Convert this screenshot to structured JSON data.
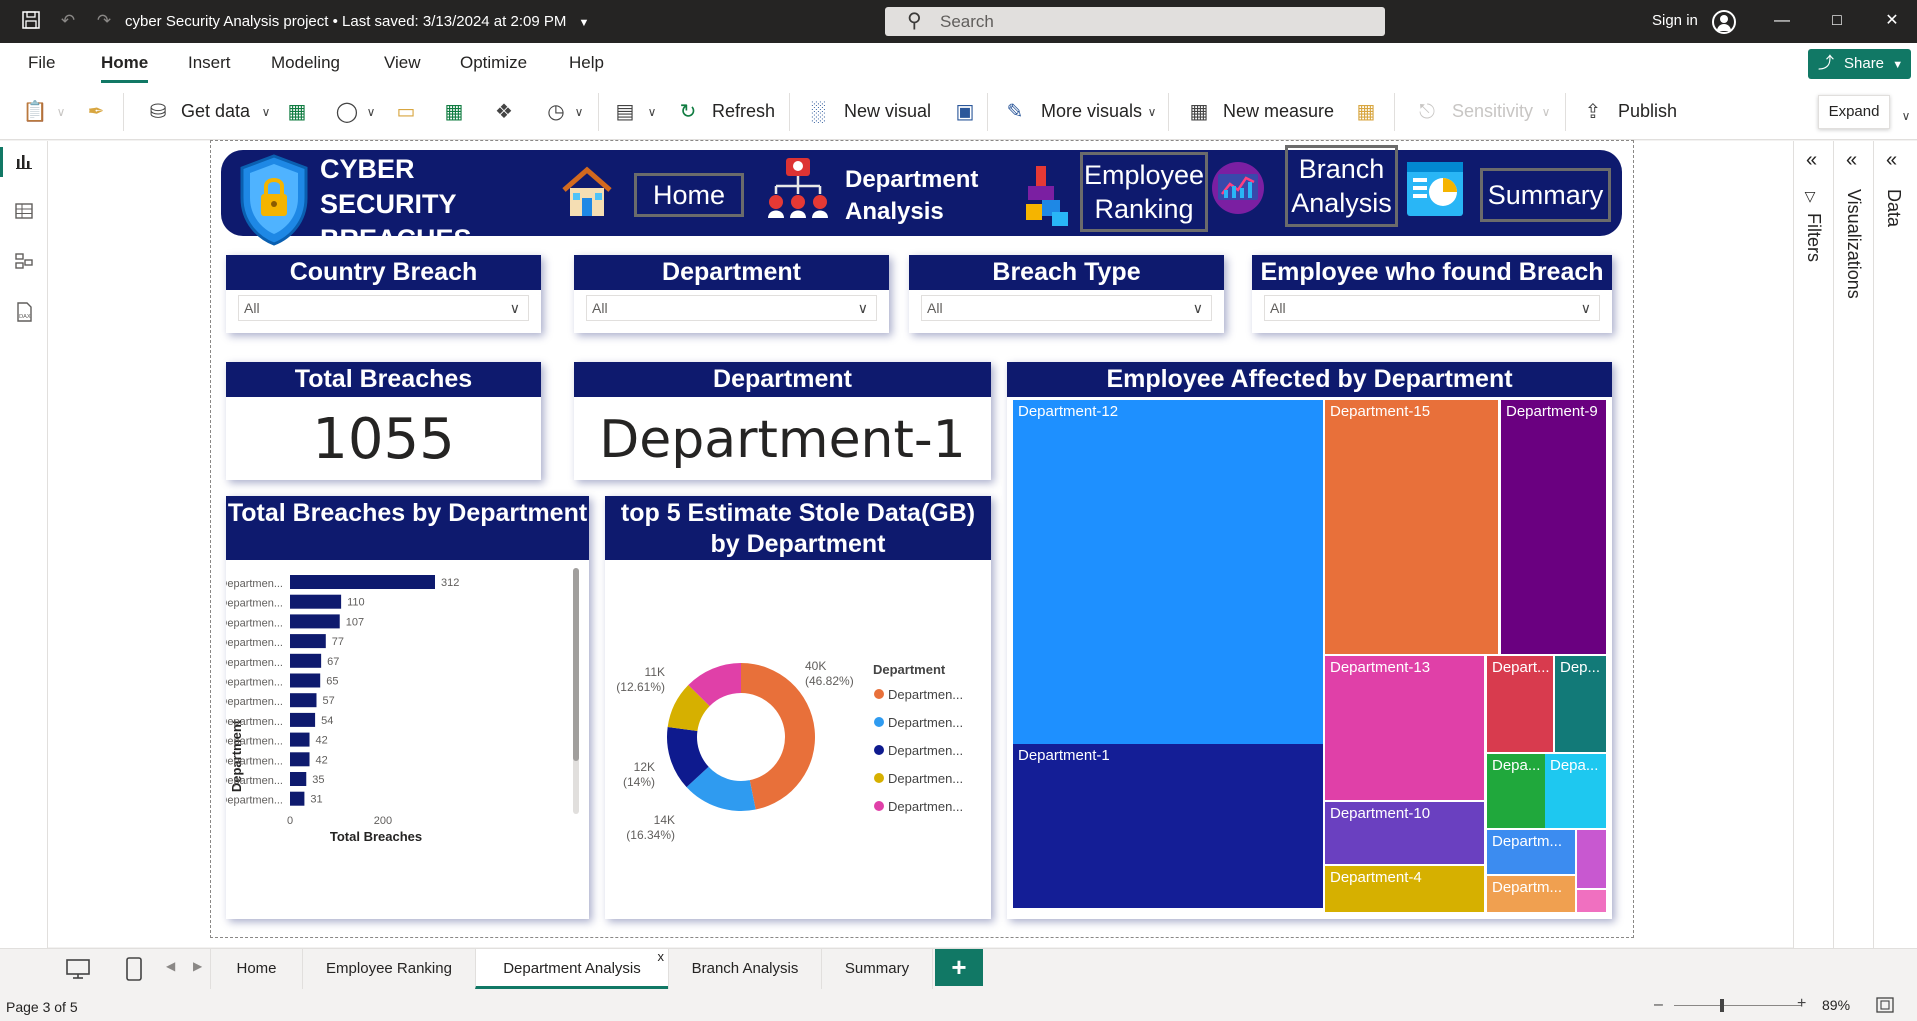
{
  "titlebar": {
    "title": "cyber Security Analysis project",
    "saved": "Last saved: 3/13/2024 at 2:09 PM",
    "search_placeholder": "Search",
    "signin": "Sign in"
  },
  "menu": [
    "File",
    "Home",
    "Insert",
    "Modeling",
    "View",
    "Optimize",
    "Help"
  ],
  "share_label": "Share",
  "ribbon": {
    "get_data": "Get data",
    "refresh": "Refresh",
    "new_visual": "New visual",
    "more_visuals": "More visuals",
    "new_measure": "New measure",
    "sensitivity": "Sensitivity",
    "publish": "Publish"
  },
  "expand_tooltip": "Expand",
  "banner": {
    "title": "CYBER SECURITY BREACHES",
    "nav_home": "Home",
    "nav_department": "Department Analysis",
    "nav_employee": "Employee Ranking",
    "nav_branch": "Branch Analysis",
    "nav_summary": "Summary"
  },
  "slicers": [
    {
      "title": "Country Breach",
      "value": "All"
    },
    {
      "title": "Department",
      "value": "All"
    },
    {
      "title": "Breach Type",
      "value": "All"
    },
    {
      "title": "Employee who found Breach",
      "value": "All"
    }
  ],
  "kpis": {
    "total_title": "Total Breaches",
    "total_value": "1055",
    "dept_title": "Department",
    "dept_value": "Department-1"
  },
  "bar_panel_title": "Total Breaches by Department",
  "donut_panel_title": "top 5 Estimate Stole Data(GB) by Department",
  "treemap_panel_title": "Employee Affected by Department",
  "chart_data": [
    {
      "type": "bar",
      "orientation": "horizontal",
      "categories": [
        "Departmen...",
        "Departmen...",
        "Departmen...",
        "Departmen...",
        "Departmen...",
        "Departmen...",
        "Departmen...",
        "Departmen...",
        "Departmen...",
        "Departmen...",
        "Departmen...",
        "Departmen..."
      ],
      "values": [
        312,
        110,
        107,
        77,
        67,
        65,
        57,
        54,
        42,
        42,
        35,
        31
      ],
      "ylabel": "Department",
      "xlabel": "Total Breaches",
      "xticks": [
        0,
        200
      ],
      "color": "#0e1a6e"
    },
    {
      "type": "pie",
      "donut": true,
      "legend_title": "Department",
      "legend": [
        "Departmen...",
        "Departmen...",
        "Departmen...",
        "Departmen...",
        "Departmen..."
      ],
      "slices": [
        {
          "value_label": "40K",
          "pct_label": "(46.82%)",
          "share": 46.82,
          "color": "#e8703a"
        },
        {
          "value_label": "14K",
          "pct_label": "(16.34%)",
          "share": 16.34,
          "color": "#2f9bf0"
        },
        {
          "value_label": "12K",
          "pct_label": "(14%)",
          "share": 14,
          "color": "#0e1a8e"
        },
        {
          "value_label": "",
          "pct_label": "",
          "share": 10.23,
          "color": "#d6b000"
        },
        {
          "value_label": "11K",
          "pct_label": "(12.61%)",
          "share": 12.61,
          "color": "#e040a8"
        }
      ]
    },
    {
      "type": "treemap",
      "nodes": [
        {
          "label": "Department-12",
          "color": "#1e90ff"
        },
        {
          "label": "Department-15",
          "color": "#e8703a"
        },
        {
          "label": "Department-9",
          "color": "#6a0080"
        },
        {
          "label": "Department-1",
          "color": "#141e96"
        },
        {
          "label": "Department-13",
          "color": "#e040a8"
        },
        {
          "label": "Depart...",
          "color": "#d83b4e"
        },
        {
          "label": "Dep...",
          "color": "#127a78"
        },
        {
          "label": "Depa...",
          "color": "#20a83c"
        },
        {
          "label": "Depa...",
          "color": "#1ec8f0"
        },
        {
          "label": "Department-10",
          "color": "#6a40c0"
        },
        {
          "label": "Department-4",
          "color": "#d6b000"
        },
        {
          "label": "Departm...",
          "color": "#3c8cf0"
        },
        {
          "label": "Departm...",
          "color": "#f0a050"
        },
        {
          "label": "",
          "color": "#c858d0"
        },
        {
          "label": "",
          "color": "#f070c0"
        }
      ]
    }
  ],
  "panes": {
    "filters": "Filters",
    "visualizations": "Visualizations",
    "data": "Data"
  },
  "tabs": [
    "Home",
    "Employee Ranking",
    "Department Analysis",
    "Branch Analysis",
    "Summary"
  ],
  "status": {
    "page": "Page 3 of 5",
    "zoom": "89%"
  }
}
